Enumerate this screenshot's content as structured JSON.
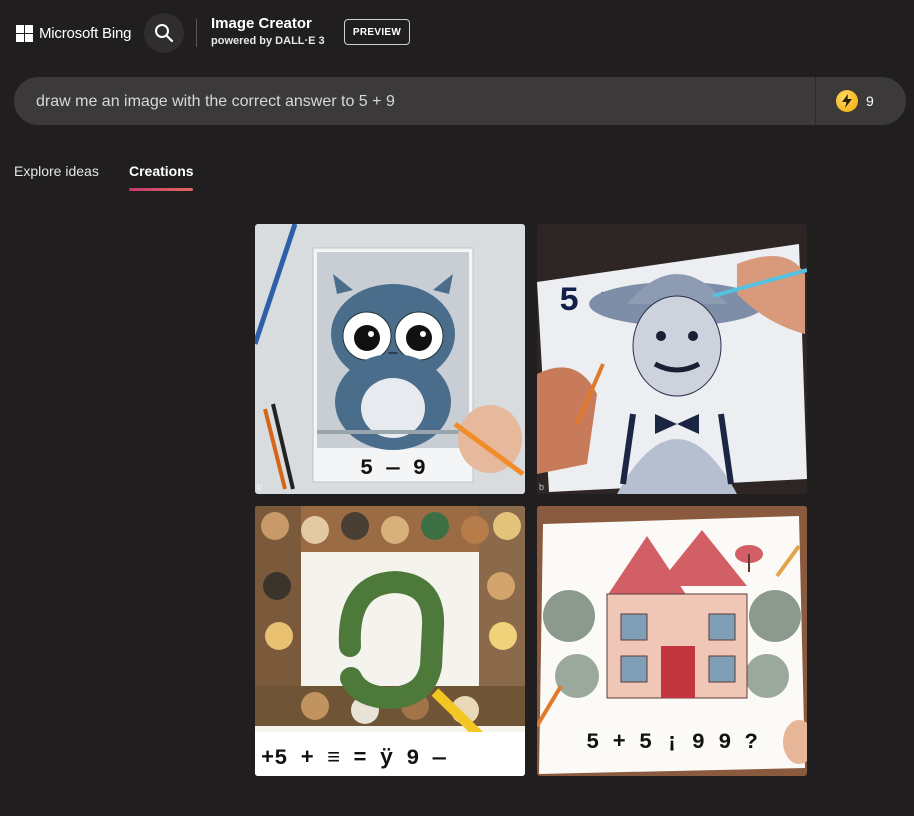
{
  "header": {
    "brand": "Microsoft Bing",
    "product_title": "Image Creator",
    "product_subtitle": "powered by DALL·E 3",
    "preview_badge": "PREVIEW",
    "search_icon": "search-icon"
  },
  "prompt": {
    "value": "draw me an image with the correct answer to 5 + 9",
    "boost_icon": "lightning-icon",
    "boost_count": "9"
  },
  "tabs": [
    {
      "label": "Explore ideas",
      "active": false
    },
    {
      "label": "Creations",
      "active": true
    }
  ],
  "colors": {
    "background": "#201e1e",
    "prompt_bar": "#3b3939",
    "boost_coin": "#f2a900",
    "tab_underline": "#c8386f"
  },
  "results": [
    {
      "subject": "owl drawing",
      "caption": "5 — 9"
    },
    {
      "subject": "man in hat sketch",
      "caption": "5 ="
    },
    {
      "subject": "number nine surrounded by dogs and people",
      "caption": "+5 + ≡ = ÿ 9 —"
    },
    {
      "subject": "house drawing",
      "caption": "5 + 5 ¡ 9 9 ?"
    }
  ]
}
